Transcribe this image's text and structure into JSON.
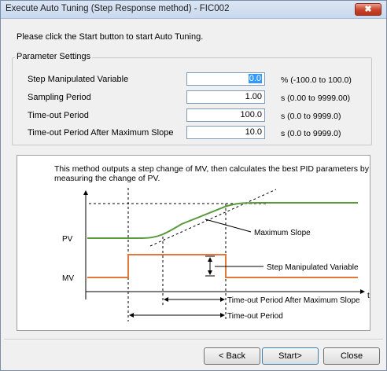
{
  "window": {
    "title": "Execute Auto Tuning (Step Response method) - FIC002",
    "close_label": "✖"
  },
  "intro_text": "Please click the Start button to start Auto Tuning.",
  "parameters": {
    "group_title": "Parameter Settings",
    "rows": [
      {
        "label": "Step Manipulated Variable",
        "value": "0.0",
        "range": "% (-100.0 to 100.0)"
      },
      {
        "label": "Sampling Period",
        "value": "1.00",
        "range": "s (0.00 to 9999.00)"
      },
      {
        "label": "Time-out Period",
        "value": "100.0",
        "range": "s (0.0 to 9999.0)"
      },
      {
        "label": "Time-out Period After Maximum Slope",
        "value": "10.0",
        "range": "s (0.0 to 9999.0)"
      }
    ]
  },
  "diagram": {
    "description": "This method outputs a step change of MV, then calculates the best PID parameters by measuring the change of PV.",
    "labels": {
      "pv": "PV",
      "mv": "MV",
      "t": "t",
      "maximum_slope": "Maximum Slope",
      "step_mv": "Step Manipulated Variable",
      "timeout_after_slope": "Time-out Period After Maximum Slope",
      "timeout": "Time-out Period"
    },
    "colors": {
      "pv": "#5a9a3a",
      "mv": "#e2783a"
    }
  },
  "buttons": {
    "back": "< Back",
    "start": "Start>",
    "close": "Close"
  }
}
